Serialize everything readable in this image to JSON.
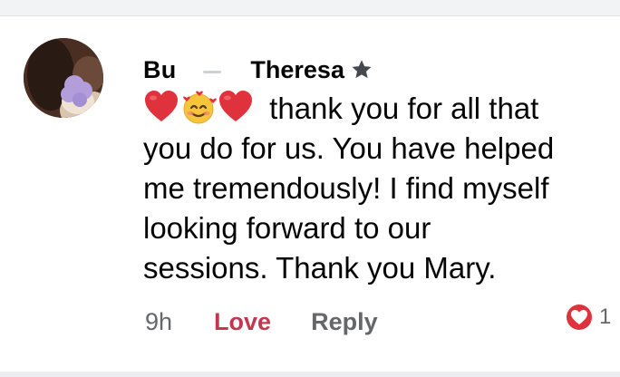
{
  "comment": {
    "author_first": "Bu",
    "author_last": "Theresa",
    "author_badge_icon": "star-icon",
    "emoji_sequence": [
      "red-heart",
      "smiling-face-with-hearts",
      "red-heart"
    ],
    "body_lines": [
      "thank you for all that",
      "you do for us. You have helped",
      "me tremendously! I find myself",
      "looking forward to our",
      "sessions. Thank you Mary."
    ],
    "time": "9h",
    "reaction_label": "Love",
    "reply_label": "Reply",
    "reaction_icon": "love-reaction-icon",
    "reaction_count": "1",
    "colors": {
      "love": "#c0394f",
      "heart": "#e0323c",
      "muted": "#65676b",
      "text": "#050505"
    }
  }
}
